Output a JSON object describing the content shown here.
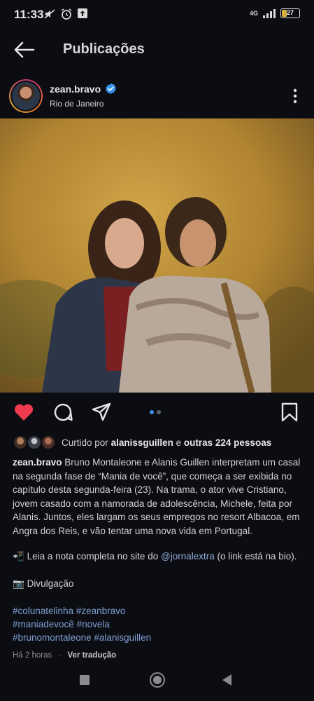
{
  "status_bar": {
    "time": "11:33",
    "network": "4G",
    "battery": "27"
  },
  "header": {
    "title": "Publicações"
  },
  "post": {
    "username": "zean.bravo",
    "location": "Rio de Janeiro",
    "carousel": {
      "count": 2,
      "active_index": 0
    },
    "liked": true,
    "likes": {
      "prefix": "Curtido por",
      "user": "alanissguillen",
      "conjunction": "e",
      "others": "outras 224 pessoas"
    },
    "caption": {
      "author": "zean.bravo",
      "body": "Bruno Montaleone e Alanis Guillen interpretam um casal na segunda fase de “Mania de você”, que começa a ser exibida no capítulo desta segunda-feira (23). Na trama, o ator vive Cristiano, jovem casado com a namorada de adolescência, Michele, feita por Alanis. Juntos, eles largam os seus empregos no resort Albacoa, em Angra dos Reis, e vão tentar uma nova vida em Portugal.",
      "note_emoji": "📲",
      "note_text": "Leia a nota completa no site do",
      "note_mention": "@jornalextra",
      "note_suffix": "(o link está na bio).",
      "credit_emoji": "📷",
      "credit_text": "Divulgação",
      "hashtags_line1": [
        "#colunatelinha",
        "#zeanbravo"
      ],
      "hashtags_line2": [
        "#maniadevocê",
        "#novela"
      ],
      "hashtags_line3": [
        "#brunomontaleone",
        "#alanisguillen"
      ]
    },
    "time_ago": "Há 2 horas",
    "separator": "·",
    "translate": "Ver tradução"
  },
  "colors": {
    "background": "#0b0d12",
    "like_red": "#ed3a4e",
    "link_blue": "#8fa9d6",
    "verified_blue": "#3797f0"
  },
  "icons": [
    "back-arrow-icon",
    "verified-badge-icon",
    "more-options-icon",
    "heart-icon",
    "comment-icon",
    "share-icon",
    "bookmark-icon"
  ]
}
